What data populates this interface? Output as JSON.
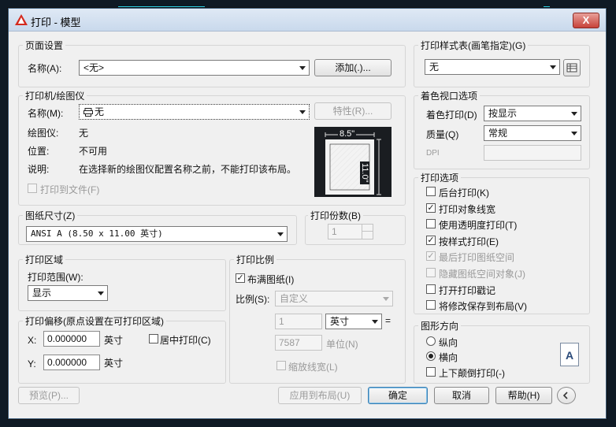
{
  "window": {
    "title": "打印 - 模型",
    "close_glyph": "X"
  },
  "page_setup": {
    "legend": "页面设置",
    "name_label": "名称(A):",
    "name_value": "<无>",
    "add_button": "添加(.)..."
  },
  "printer": {
    "legend": "打印机/绘图仪",
    "name_label": "名称(M):",
    "name_value": "无",
    "properties_button": "特性(R)...",
    "plotter_label": "绘图仪:",
    "plotter_value": "无",
    "location_label": "位置:",
    "location_value": "不可用",
    "description_label": "说明:",
    "description_value": "在选择新的绘图仪配置名称之前，不能打印该布局。",
    "print_to_file": "打印到文件(F)",
    "preview_width": "8.5\"",
    "preview_height": "11.0\""
  },
  "paper_size": {
    "legend": "图纸尺寸(Z)",
    "value": "ANSI A (8.50 x 11.00 英寸)"
  },
  "copies": {
    "legend": "打印份数(B)",
    "value": "1"
  },
  "plot_area": {
    "legend": "打印区域",
    "range_label": "打印范围(W):",
    "range_value": "显示"
  },
  "plot_offset": {
    "legend": "打印偏移(原点设置在可打印区域)",
    "x_label": "X:",
    "x_value": "0.000000",
    "x_unit": "英寸",
    "y_label": "Y:",
    "y_value": "0.000000",
    "y_unit": "英寸",
    "center_plot": "居中打印(C)"
  },
  "plot_scale": {
    "legend": "打印比例",
    "fit_to_paper": "布满图纸(I)",
    "scale_label": "比例(S):",
    "scale_value": "自定义",
    "value1": "1",
    "unit1": "英寸",
    "equals": "=",
    "value2": "7587",
    "unit2": "单位(N)",
    "scale_lineweights": "缩放线宽(L)"
  },
  "plot_style_table": {
    "legend": "打印样式表(画笔指定)(G)",
    "value": "无"
  },
  "shaded_viewport": {
    "legend": "着色视口选项",
    "shade_label": "着色打印(D)",
    "shade_value": "按显示",
    "quality_label": "质量(Q)",
    "quality_value": "常规",
    "dpi_label": "DPI"
  },
  "plot_options": {
    "legend": "打印选项",
    "items": [
      {
        "label": "后台打印(K)",
        "checked": false,
        "disabled": false
      },
      {
        "label": "打印对象线宽",
        "checked": true,
        "disabled": false
      },
      {
        "label": "使用透明度打印(T)",
        "checked": false,
        "disabled": false
      },
      {
        "label": "按样式打印(E)",
        "checked": true,
        "disabled": false
      },
      {
        "label": "最后打印图纸空间",
        "checked": true,
        "disabled": true
      },
      {
        "label": "隐藏图纸空间对象(J)",
        "checked": false,
        "disabled": true
      },
      {
        "label": "打开打印戳记",
        "checked": false,
        "disabled": false
      },
      {
        "label": "将修改保存到布局(V)",
        "checked": false,
        "disabled": false
      }
    ]
  },
  "orientation": {
    "legend": "图形方向",
    "portrait": "纵向",
    "landscape": "横向",
    "upside_down": "上下颠倒打印(-)",
    "icon_letter": "A"
  },
  "footer": {
    "preview_button": "预览(P)...",
    "apply_button": "应用到布局(U)",
    "ok_button": "确定",
    "cancel_button": "取消",
    "help_button": "帮助(H)"
  },
  "colors": {
    "accent_cyan": "#2fd3e8",
    "title_red": "#c7423a",
    "preview_bg": "#1a1d21"
  }
}
